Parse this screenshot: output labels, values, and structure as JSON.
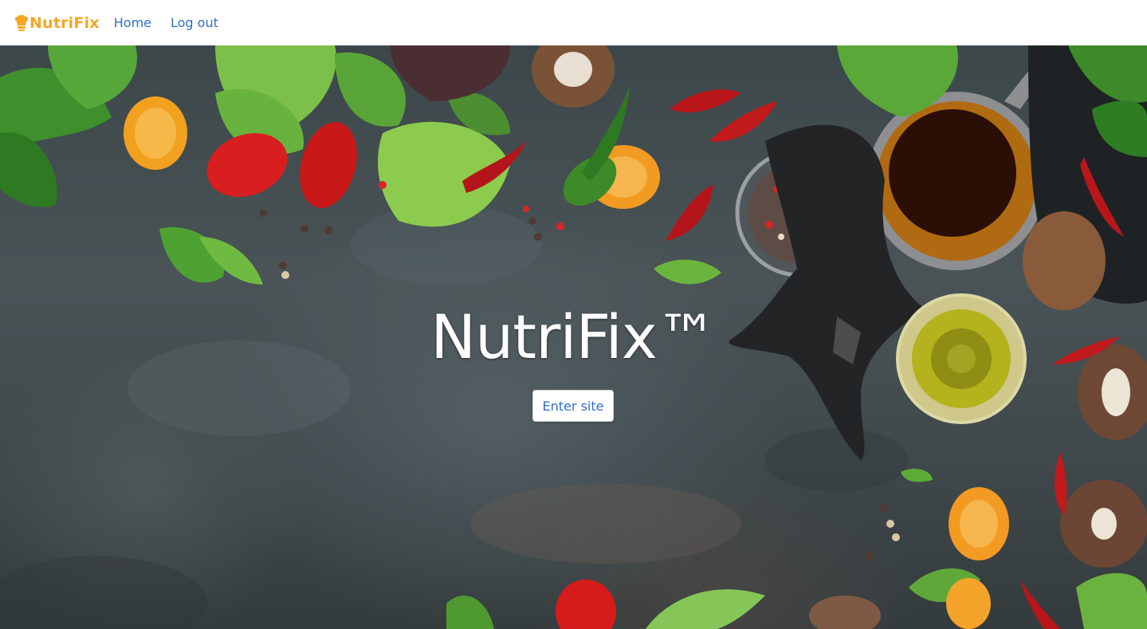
{
  "navbar": {
    "brand": {
      "icon": "chef-hat-icon",
      "text": "NutriFix",
      "color": "#f5a623"
    },
    "links": [
      {
        "label": "Home"
      },
      {
        "label": "Log out"
      }
    ],
    "link_color": "#2f6fc8"
  },
  "hero": {
    "title": "NutriFix™",
    "button_label": "Enter site",
    "background": "food-ingredients-photo"
  }
}
